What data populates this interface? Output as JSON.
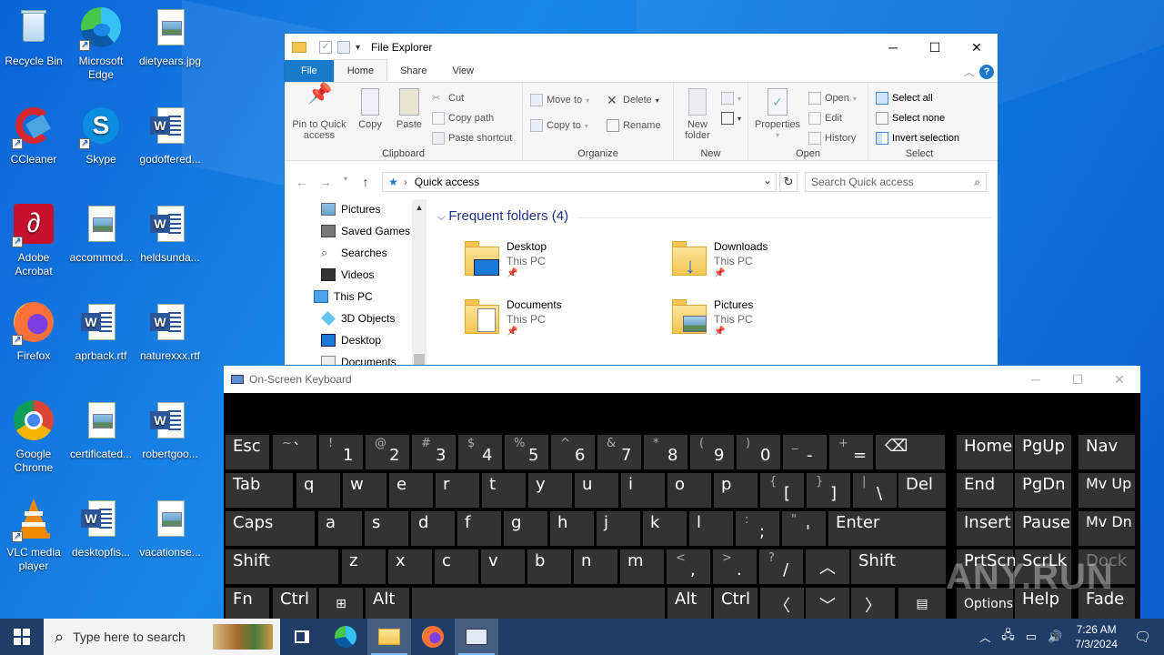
{
  "desktop": {
    "icons": [
      {
        "label": "Recycle Bin"
      },
      {
        "label": "Microsoft Edge"
      },
      {
        "label": "dietyears.jpg"
      },
      {
        "label": "CCleaner"
      },
      {
        "label": "Skype"
      },
      {
        "label": "godoffered..."
      },
      {
        "label": "Adobe Acrobat"
      },
      {
        "label": "accommod..."
      },
      {
        "label": "heldsunda..."
      },
      {
        "label": "Firefox"
      },
      {
        "label": "aprback.rtf"
      },
      {
        "label": "naturexxx.rtf"
      },
      {
        "label": "Google Chrome"
      },
      {
        "label": "certificated..."
      },
      {
        "label": "robertgoo..."
      },
      {
        "label": "VLC media player"
      },
      {
        "label": "desktopfis..."
      },
      {
        "label": "vacationse..."
      }
    ]
  },
  "explorer": {
    "title": "File Explorer",
    "tabs": {
      "file": "File",
      "home": "Home",
      "share": "Share",
      "view": "View"
    },
    "ribbon": {
      "pin": "Pin to Quick access",
      "copy": "Copy",
      "paste": "Paste",
      "cut": "Cut",
      "copy_path": "Copy path",
      "paste_shortcut": "Paste shortcut",
      "clipboard": "Clipboard",
      "move_to": "Move to",
      "copy_to": "Copy to",
      "delete": "Delete",
      "rename": "Rename",
      "organize": "Organize",
      "new_folder": "New folder",
      "new": "New",
      "properties": "Properties",
      "open": "Open",
      "edit": "Edit",
      "history": "History",
      "open_group": "Open",
      "select_all": "Select all",
      "select_none": "Select none",
      "invert_selection": "Invert selection",
      "select_group": "Select"
    },
    "address": "Quick access",
    "search_placeholder": "Search Quick access",
    "nav": [
      "Pictures",
      "Saved Games",
      "Searches",
      "Videos",
      "This PC",
      "3D Objects",
      "Desktop",
      "Documents"
    ],
    "frequent_header": "Frequent folders (4)",
    "folders": [
      {
        "name": "Desktop",
        "location": "This PC"
      },
      {
        "name": "Downloads",
        "location": "This PC"
      },
      {
        "name": "Documents",
        "location": "This PC"
      },
      {
        "name": "Pictures",
        "location": "This PC"
      }
    ]
  },
  "osk": {
    "title": "On-Screen Keyboard",
    "keys": {
      "esc": "Esc",
      "tab": "Tab",
      "caps": "Caps",
      "shift": "Shift",
      "fn": "Fn",
      "ctrl": "Ctrl",
      "alt": "Alt",
      "del": "Del",
      "enter": "Enter",
      "home": "Home",
      "pgup": "PgUp",
      "nav": "Nav",
      "end": "End",
      "pgdn": "PgDn",
      "mvup": "Mv Up",
      "insert": "Insert",
      "pause": "Pause",
      "mvdn": "Mv Dn",
      "prtscn": "PrtScn",
      "scrlk": "ScrLk",
      "dock": "Dock",
      "options": "Options",
      "help": "Help",
      "fade": "Fade"
    }
  },
  "taskbar": {
    "search_placeholder": "Type here to search",
    "time": "7:26 AM",
    "date": "7/3/2024"
  },
  "watermark": "ANY.RUN"
}
